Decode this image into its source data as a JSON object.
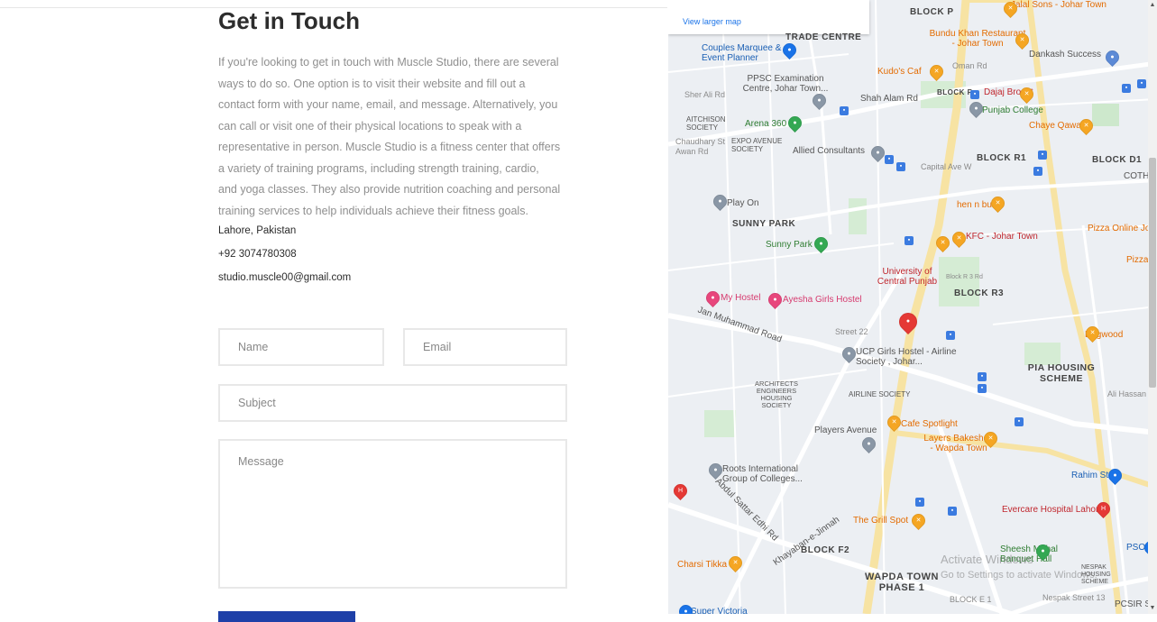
{
  "contact": {
    "title": "Get in Touch",
    "intro": "If you're looking to get in touch with Muscle Studio, there are several ways to do so. One option is to visit their website and fill out a contact form with your name, email, and message. Alternatively, you can call or visit one of their physical locations to speak with a representative in person. Muscle Studio is a fitness center that offers a variety of training programs, including strength training, cardio, and yoga classes. They also provide nutrition coaching and personal training services to help individuals achieve their fitness goals.",
    "location": "Lahore, Pakistan",
    "phone": "+92 3074780308",
    "email": "studio.muscle00@gmail.com"
  },
  "form": {
    "name_placeholder": "Name",
    "email_placeholder": "Email",
    "subject_placeholder": "Subject",
    "message_placeholder": "Message"
  },
  "map": {
    "view_larger": "View larger map",
    "accent_color": "#e53935",
    "labels": {
      "block_p": "BLOCK P",
      "jalal_sons": "Jalal Sons - Johar Town",
      "trade_centre": "TRADE CENTRE",
      "bundu_khan": "Bundu Khan Restaurant - Johar Town",
      "couples_marquee": "Couples Marquee & Event Planner",
      "dankash": "Dankash Success",
      "kudos": "Kudo's Caf",
      "oman_rd": "Oman Rd",
      "ppsc": "PPSC Examination Centre, Johar Town...",
      "sher_ali": "Sher Ali Rd",
      "shah_alam": "Shah Alam Rd",
      "block_r": "BLOCK R",
      "dajaj": "Dajaj Broast",
      "punjab_college": "Punjab College",
      "aitchison": "AITCHISON SOCIETY",
      "arena": "Arena 360",
      "chaye": "Chaye Qawali",
      "chaudhary": "Chaudhary St",
      "expo": "EXPO AVENUE SOCIETY",
      "awan": "Awan Rd",
      "allied": "Allied Consultants",
      "capital": "Capital Ave W",
      "block_r1": "BLOCK R1",
      "block_d1": "BLOCK D1",
      "cothm": "COTHM",
      "play_on": "Play On",
      "hen_n_bun": "hen n bun",
      "sunny_park_area": "SUNNY PARK",
      "sunny_park": "Sunny Park",
      "kfc": "KFC - Johar Town",
      "pizza_online": "Pizza Online Jo",
      "pizza_m": "Pizza M",
      "university": "University of Central Punjab",
      "block_r3": "BLOCK R3",
      "block_r3_rd": "Block R 3 Rd",
      "my_hostel": "My Hostel",
      "ayesha": "Ayesha Girls Hostel",
      "jan_muhammad": "Jan Muhammad Road",
      "street_22": "Street 22",
      "dagwood": "Dagwood",
      "ucp_hostel": "UCP Girls Hostel - Airline Society , Johar...",
      "pia": "PIA HOUSING SCHEME",
      "architects": "ARCHITECTS ENGINEERS HOUSING SOCIETY",
      "airline": "AIRLINE SOCIETY",
      "ali_hassan": "Ali Hassan St",
      "cafe_spotlight": "Cafe Spotlight",
      "players": "Players Avenue",
      "layers": "Layers Bakeshop - Wapda Town",
      "roots": "Roots International Group of Colleges...",
      "rahim": "Rahim Store",
      "evercare": "Evercare Hospital Lahore",
      "grill_spot": "The Grill Spot",
      "charsi": "Charsi Tikka",
      "block_f2": "BLOCK F2",
      "sheesh": "Sheesh Mahal Banquet Hall",
      "pso": "PSO P",
      "wapda_town": "WAPDA TOWN PHASE 1",
      "nespak": "NESPAK HOUSING SCHEME",
      "nespak_st": "Nespak Street 13",
      "block_e1": "BLOCK E 1",
      "pcsir": "PCSIR S",
      "super_victoria": "Super Victoria",
      "khayaban": "Khayaban-e-Jinnah",
      "abdul_sattar": "Abdul Sattar Edhi Rd"
    }
  },
  "watermark": {
    "line": "Activate Windows",
    "sub": "Go to Settings to activate Windows."
  }
}
